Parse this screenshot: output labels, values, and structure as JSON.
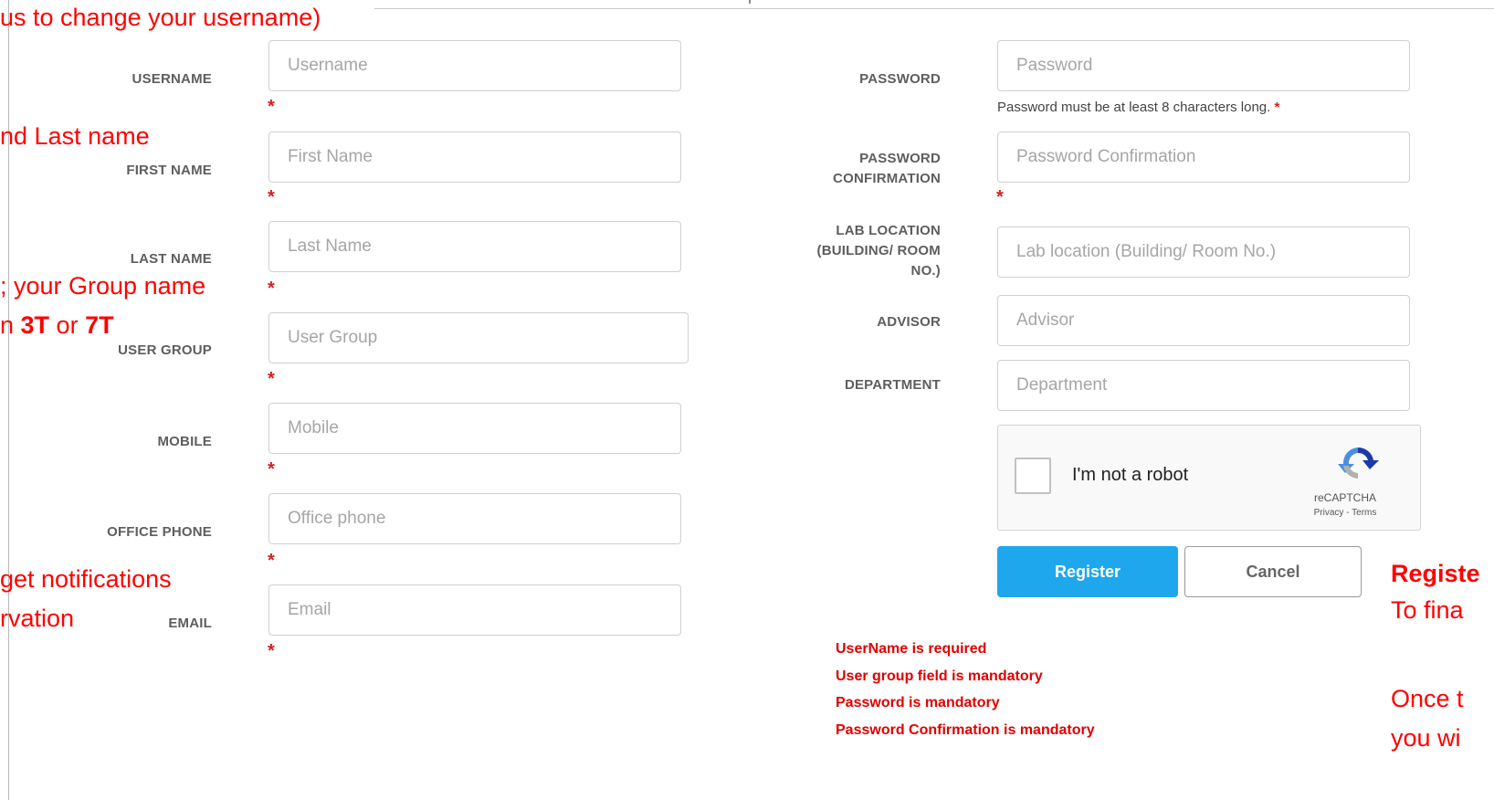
{
  "callouts": {
    "username_note": "us to change your username)",
    "name_note": "nd Last name",
    "group_note_1": "; your Group name",
    "group_note_2_prefix": "n ",
    "group_note_2_3t": "3T",
    "group_note_2_or": " or ",
    "group_note_2_7t": "7T",
    "email_note_1": " get notifications",
    "email_note_2": "rvation",
    "register_note_1": "Registe",
    "register_note_2": "To fina",
    "register_note_3": "Once t",
    "register_note_4": "you wi"
  },
  "form": {
    "username": {
      "label": "USERNAME",
      "placeholder": "Username"
    },
    "first_name": {
      "label": "FIRST NAME",
      "placeholder": "First Name"
    },
    "last_name": {
      "label": "LAST NAME",
      "placeholder": "Last Name"
    },
    "user_group": {
      "label": "USER GROUP",
      "placeholder": "User Group"
    },
    "mobile": {
      "label": "MOBILE",
      "placeholder": "Mobile"
    },
    "office_phone": {
      "label": "OFFICE PHONE",
      "placeholder": "Office phone"
    },
    "email": {
      "label": "EMAIL",
      "placeholder": "Email"
    },
    "password": {
      "label": "PASSWORD",
      "placeholder": "Password",
      "hint": "Password must be at least 8 characters long."
    },
    "password_confirmation": {
      "label_1": "PASSWORD",
      "label_2": "CONFIRMATION",
      "placeholder": "Password Confirmation"
    },
    "lab_location": {
      "label_1": "LAB LOCATION",
      "label_2": "(BUILDING/ ROOM",
      "label_3": "NO.)",
      "placeholder": "Lab location (Building/ Room No.)"
    },
    "advisor": {
      "label": "ADVISOR",
      "placeholder": "Advisor"
    },
    "department": {
      "label": "DEPARTMENT",
      "placeholder": "Department"
    },
    "required_mark": "*"
  },
  "captcha": {
    "label": "I'm not a robot",
    "brand": "reCAPTCHA",
    "terms": "Privacy - Terms"
  },
  "buttons": {
    "register": "Register",
    "cancel": "Cancel"
  },
  "errors": [
    "UserName is required",
    "User group field is mandatory",
    "Password is mandatory",
    "Password Confirmation is mandatory"
  ],
  "colors": {
    "annotation": "#ff0000",
    "register_button": "#1ea7ec",
    "error": "#e00000"
  }
}
